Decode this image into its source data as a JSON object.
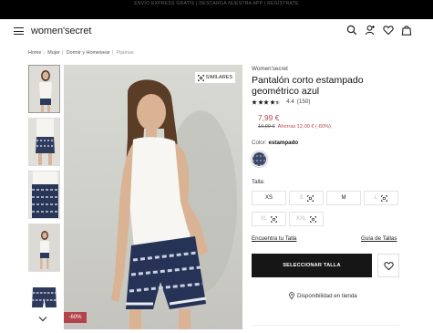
{
  "promo": "ENVÍO EXPRESS GRATIS | DESCARGA NUESTRA APP | REGÍSTRATE",
  "brand": "women'secret",
  "breadcrumb": [
    "Home",
    "Mujer",
    "Dormir y Homewear",
    "Pijamas"
  ],
  "header_icons": [
    "search-icon",
    "user-icon",
    "heart-icon",
    "bag-icon"
  ],
  "gallery": {
    "similares_label": "SIMILARES",
    "discount_badge": "-60%"
  },
  "product": {
    "brand": "Women'secret",
    "title_line1": "Pantalón corto estampado",
    "title_line2": "geométrico azul",
    "rating_value": "4.4",
    "rating_count": "(150)",
    "rating_stars": 4.4,
    "price_now": "7,99 €",
    "price_old": "19,99 €",
    "savings": "Ahorras 12,00 € (-60%)",
    "color_label": "Color:",
    "color_value": "estampado",
    "size_label": "Talla:",
    "sizes": [
      {
        "label": "XS",
        "available": true
      },
      {
        "label": "S",
        "available": false
      },
      {
        "label": "M",
        "available": true
      },
      {
        "label": "L",
        "available": false
      },
      {
        "label": "XL",
        "available": false
      },
      {
        "label": "XXL",
        "available": false
      }
    ],
    "find_size": "Encuentra tu Talla",
    "size_guide": "Guía de Tallas",
    "select_size_button": "SELECCIONAR TALLA",
    "store_availability": "Disponibilidad en tienda"
  },
  "colors": {
    "accent_price": "#b2434b",
    "button": "#161616"
  }
}
